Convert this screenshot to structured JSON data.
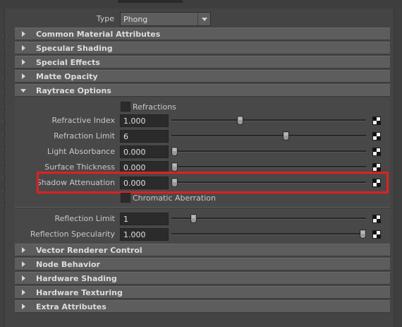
{
  "type_row": {
    "label": "Type",
    "value": "Phong"
  },
  "sections_top": [
    {
      "label": "Common Material Attributes"
    },
    {
      "label": "Specular Shading"
    },
    {
      "label": "Special Effects"
    },
    {
      "label": "Matte Opacity"
    }
  ],
  "raytrace": {
    "title": "Raytrace Options",
    "refractions_label": "Refractions",
    "refractions_checked": false,
    "chromatic_label": "Chromatic Aberration",
    "chromatic_checked": false,
    "rows": [
      {
        "label": "Refractive Index",
        "value": "1.000",
        "slider_fraction": 0.35
      },
      {
        "label": "Refraction Limit",
        "value": "6",
        "slider_fraction": 0.59
      },
      {
        "label": "Light Absorbance",
        "value": "0.000",
        "slider_fraction": 0.0
      },
      {
        "label": "Surface Thickness",
        "value": "0.000",
        "slider_fraction": 0.0
      },
      {
        "label": "Shadow Attenuation",
        "value": "0.000",
        "slider_fraction": 0.0
      }
    ],
    "rows2": [
      {
        "label": "Reflection Limit",
        "value": "1",
        "slider_fraction": 0.1
      },
      {
        "label": "Reflection Specularity",
        "value": "1.000",
        "slider_fraction": 1.0
      }
    ]
  },
  "sections_bottom": [
    {
      "label": "Vector Renderer Control"
    },
    {
      "label": "Node Behavior"
    },
    {
      "label": "Hardware Shading"
    },
    {
      "label": "Hardware Texturing"
    },
    {
      "label": "Extra Attributes"
    }
  ],
  "highlight_color": "#e02020"
}
